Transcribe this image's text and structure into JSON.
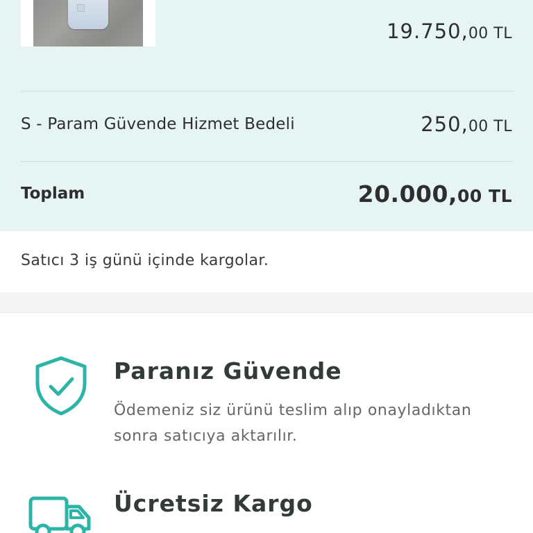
{
  "order_summary": {
    "item_price": {
      "main": "19.750,",
      "sub": "00 TL"
    },
    "service_fee": {
      "label": "S - Param Güvende Hizmet Bedeli",
      "price": {
        "main": "250,",
        "sub": "00 TL"
      }
    },
    "total": {
      "label": "Toplam",
      "price": {
        "main": "20.000,",
        "sub": "00 TL"
      }
    }
  },
  "shipping_note": "Satıcı 3 iş günü içinde kargolar.",
  "features": [
    {
      "icon": "shield-check-icon",
      "title": "Paranız Güvende",
      "description": "Ödemeniz siz ürünü teslim alıp onayladıktan sonra satıcıya aktarılır."
    },
    {
      "icon": "truck-icon",
      "title": "Ücretsiz Kargo"
    }
  ],
  "colors": {
    "summary_background": "#e6f5f4",
    "accent": "#2cb5a7",
    "divider": "#c7e2df"
  }
}
